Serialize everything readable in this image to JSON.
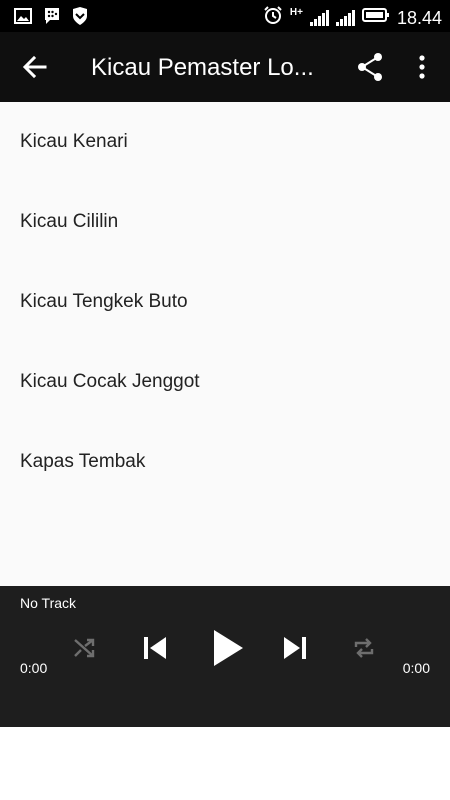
{
  "status_bar": {
    "time": "18.44",
    "network_type": "H+",
    "icons": [
      "gallery-icon",
      "bbm-icon",
      "shield-icon",
      "alarm-icon",
      "signal-icon",
      "signal-icon",
      "battery-icon"
    ]
  },
  "toolbar": {
    "title": "Kicau Pemaster Lo...",
    "back_icon": "arrow-back-icon",
    "share_icon": "share-icon",
    "more_icon": "more-vert-icon"
  },
  "songs": [
    {
      "label": "Kicau Kenari"
    },
    {
      "label": "Kicau Cililin"
    },
    {
      "label": "Kicau Tengkek Buto"
    },
    {
      "label": "Kicau Cocak Jenggot"
    },
    {
      "label": "Kapas Tembak"
    }
  ],
  "player": {
    "track_name": "No Track",
    "time_elapsed": "0:00",
    "time_total": "0:00",
    "controls": [
      "shuffle-icon",
      "skip-previous-icon",
      "play-icon",
      "skip-next-icon",
      "repeat-icon"
    ],
    "colors": {
      "background": "#1e1e1e",
      "active_icon": "#ffffff",
      "inactive_icon": "#6e6e6e"
    }
  },
  "colors": {
    "toolbar": "#0f0f0f",
    "list_background": "#fafafa",
    "text": "#222222"
  }
}
